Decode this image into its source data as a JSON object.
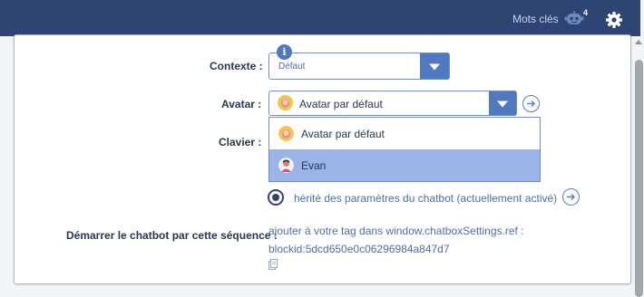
{
  "header": {
    "keywords_label": "Mots clés",
    "keywords_count": "4"
  },
  "form": {
    "context": {
      "label": "Contexte :",
      "value": "Défaut"
    },
    "avatar": {
      "label": "Avatar :",
      "value": "Avatar par défaut",
      "options": [
        {
          "label": "Avatar par défaut",
          "selected": false
        },
        {
          "label": "Evan",
          "selected": true
        }
      ]
    },
    "keyboard": {
      "label": "Clavier :",
      "radio_label": "hérité des paramètres du chatbot (actuellement activé)"
    },
    "start_sequence": {
      "label": "Démarrer le chatbot par cette séquence :",
      "instruction": "ajouter à votre tag dans window.chatboxSettings.ref :",
      "blockid": "blockid:5dcd650e0c06296984a847d7"
    }
  },
  "colors": {
    "header_bg": "#2e4472",
    "accent": "#5079bf",
    "selected_option": "#9ab4e8"
  }
}
